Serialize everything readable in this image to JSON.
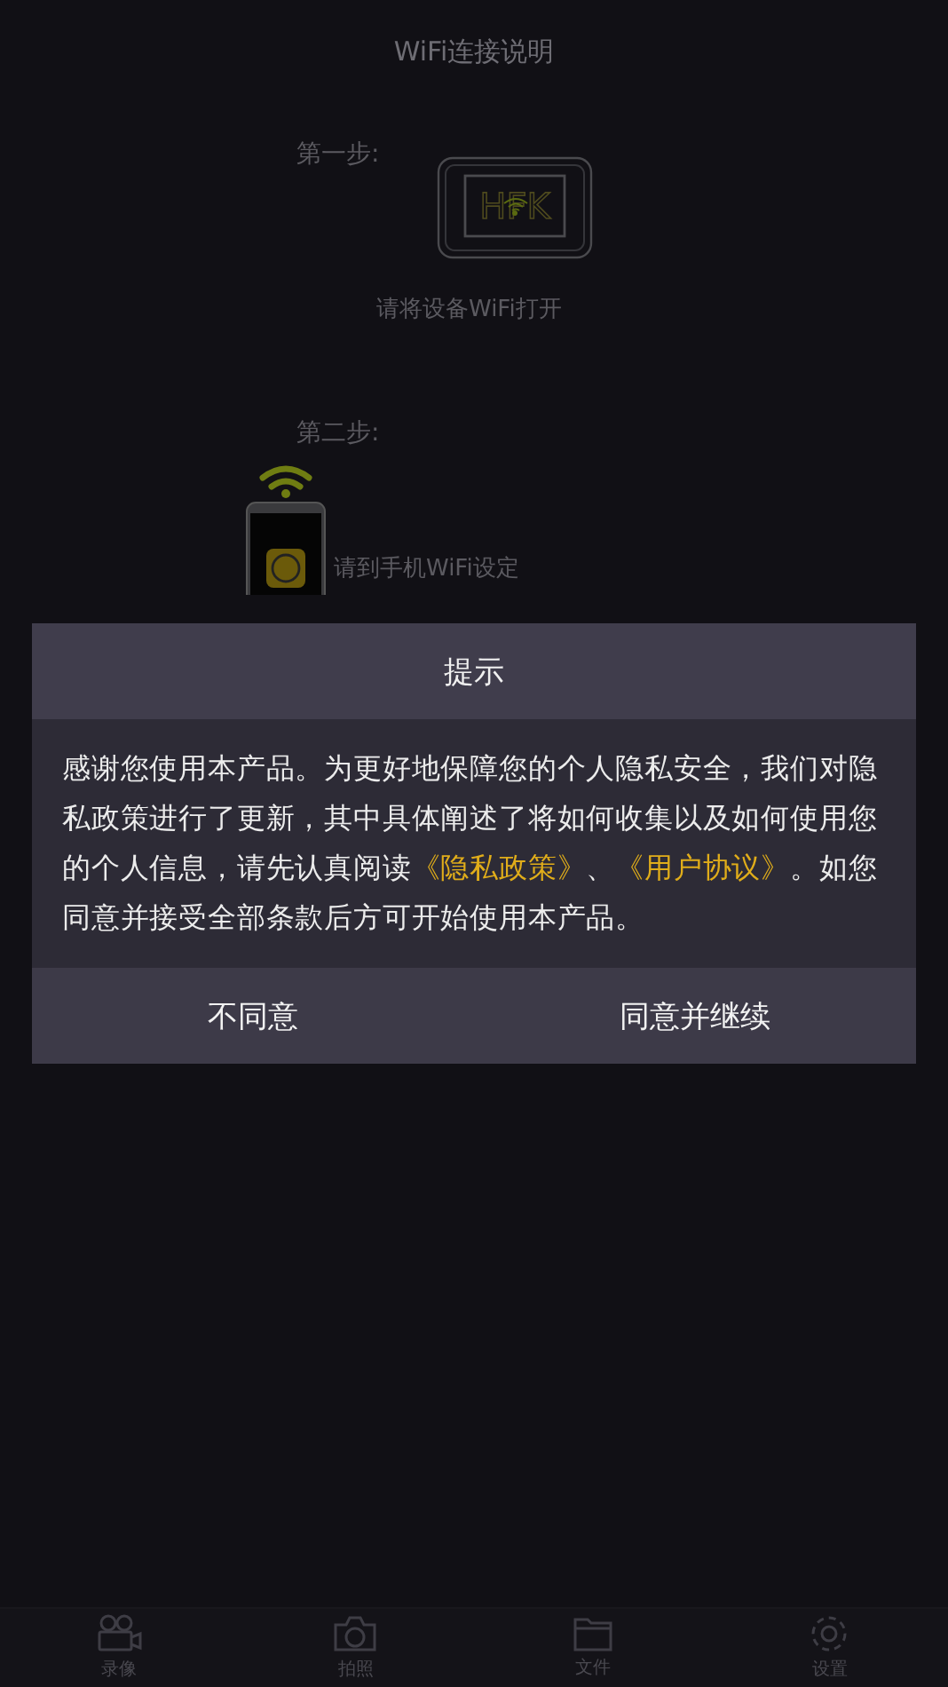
{
  "screen": {
    "title": "WiFi连接说明"
  },
  "steps": [
    {
      "label": "第一步:",
      "caption": "请将设备WiFi打开",
      "kind": "device",
      "logo": "HFK"
    },
    {
      "label": "第二步:",
      "caption": "请到手机WiFi设定",
      "kind": "phone"
    }
  ],
  "dialog": {
    "title": "提示",
    "message": [
      {
        "kind": "plain",
        "text": "感谢您使用本产品。为更好地保障您的个人隐私安全，我们对隐私政策进行了更新，其中具体阐述了将如何收集以及如何使用您的个人信息，请先认真阅读"
      },
      {
        "kind": "link",
        "text": "《隐私政策》"
      },
      {
        "kind": "plain",
        "text": "、"
      },
      {
        "kind": "link",
        "text": "《用户协议》"
      },
      {
        "kind": "plain",
        "text": "。如您同意并接受全部条款后方可开始使用本产品。"
      }
    ],
    "buttons": [
      "不同意",
      "同意并继续"
    ]
  },
  "tab_bar": [
    {
      "label": "录像",
      "kind": "video"
    },
    {
      "label": "拍照",
      "kind": "camera"
    },
    {
      "label": "文件",
      "kind": "folder"
    },
    {
      "label": "设置",
      "kind": "settings"
    }
  ]
}
